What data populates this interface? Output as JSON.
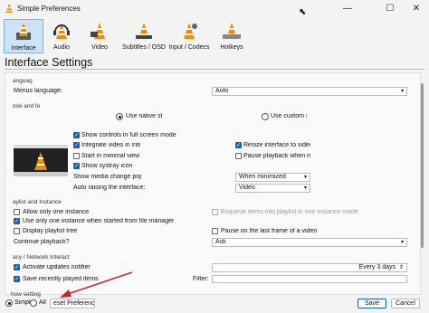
{
  "window": {
    "title": "Simple Preferences",
    "minimize": "—",
    "maximize": "☐",
    "close": "✕"
  },
  "categories": [
    {
      "label": "Interface",
      "icon": "interface-cone-icon",
      "selected": true
    },
    {
      "label": "Audio",
      "icon": "audio-cone-headphones-icon"
    },
    {
      "label": "Video",
      "icon": "video-cone-icon"
    },
    {
      "label": "Subtitles / OSD",
      "icon": "subtitles-cone-icon"
    },
    {
      "label": "Input / Codecs",
      "icon": "input-codecs-cone-icon"
    },
    {
      "label": "Hotkeys",
      "icon": "hotkeys-cone-icon"
    }
  ],
  "header": "Interface Settings",
  "language": {
    "section": "anguag",
    "label": "Menus language:",
    "value": "Auto"
  },
  "look": {
    "section": "ook and fe",
    "native_label": "Use native st",
    "custom_label": "Use custom s",
    "fullscreen_controls": "Show controls in full screen mode",
    "integrate_video": "Integrate video in inter",
    "minimal_view": "Start in minimal view m",
    "systray": "Show systray icon",
    "media_popup_label": "Show media change popu",
    "media_popup_value": "When minimized",
    "auto_raise_label": "Auto raising the interface:",
    "auto_raise_value": "Video",
    "resize_interface": "Resize interface to video s",
    "pause_minimized": "Pause playback when mi"
  },
  "playlist": {
    "section": "aylist and Instance",
    "one_instance": "Allow only one instance",
    "one_instance_file_manager": "Use only one instance when started from file manager",
    "display_tree": "Display playlist tree",
    "continue_label": "Continue playback?",
    "continue_value": "Ask",
    "enqueue": "Enqueue items into playlist in one instance mode",
    "pause_last_frame": "Pause on the last frame of a video"
  },
  "privacy": {
    "section": "acy / Network Interact",
    "updates": "Activate updates notifier",
    "updates_every": "Every 3 days",
    "recent": "Save recently played items",
    "filter_label": "Filter:"
  },
  "footer": {
    "show_settings": "how setting",
    "simple": "Simpl",
    "all": "All",
    "reset": "eset Preferenc",
    "save": "Save",
    "cancel": "Cancel"
  },
  "colors": {
    "accent": "#1a5fb4",
    "annotation_arrow": "#c0282a",
    "cone_orange": "#f08a00"
  }
}
